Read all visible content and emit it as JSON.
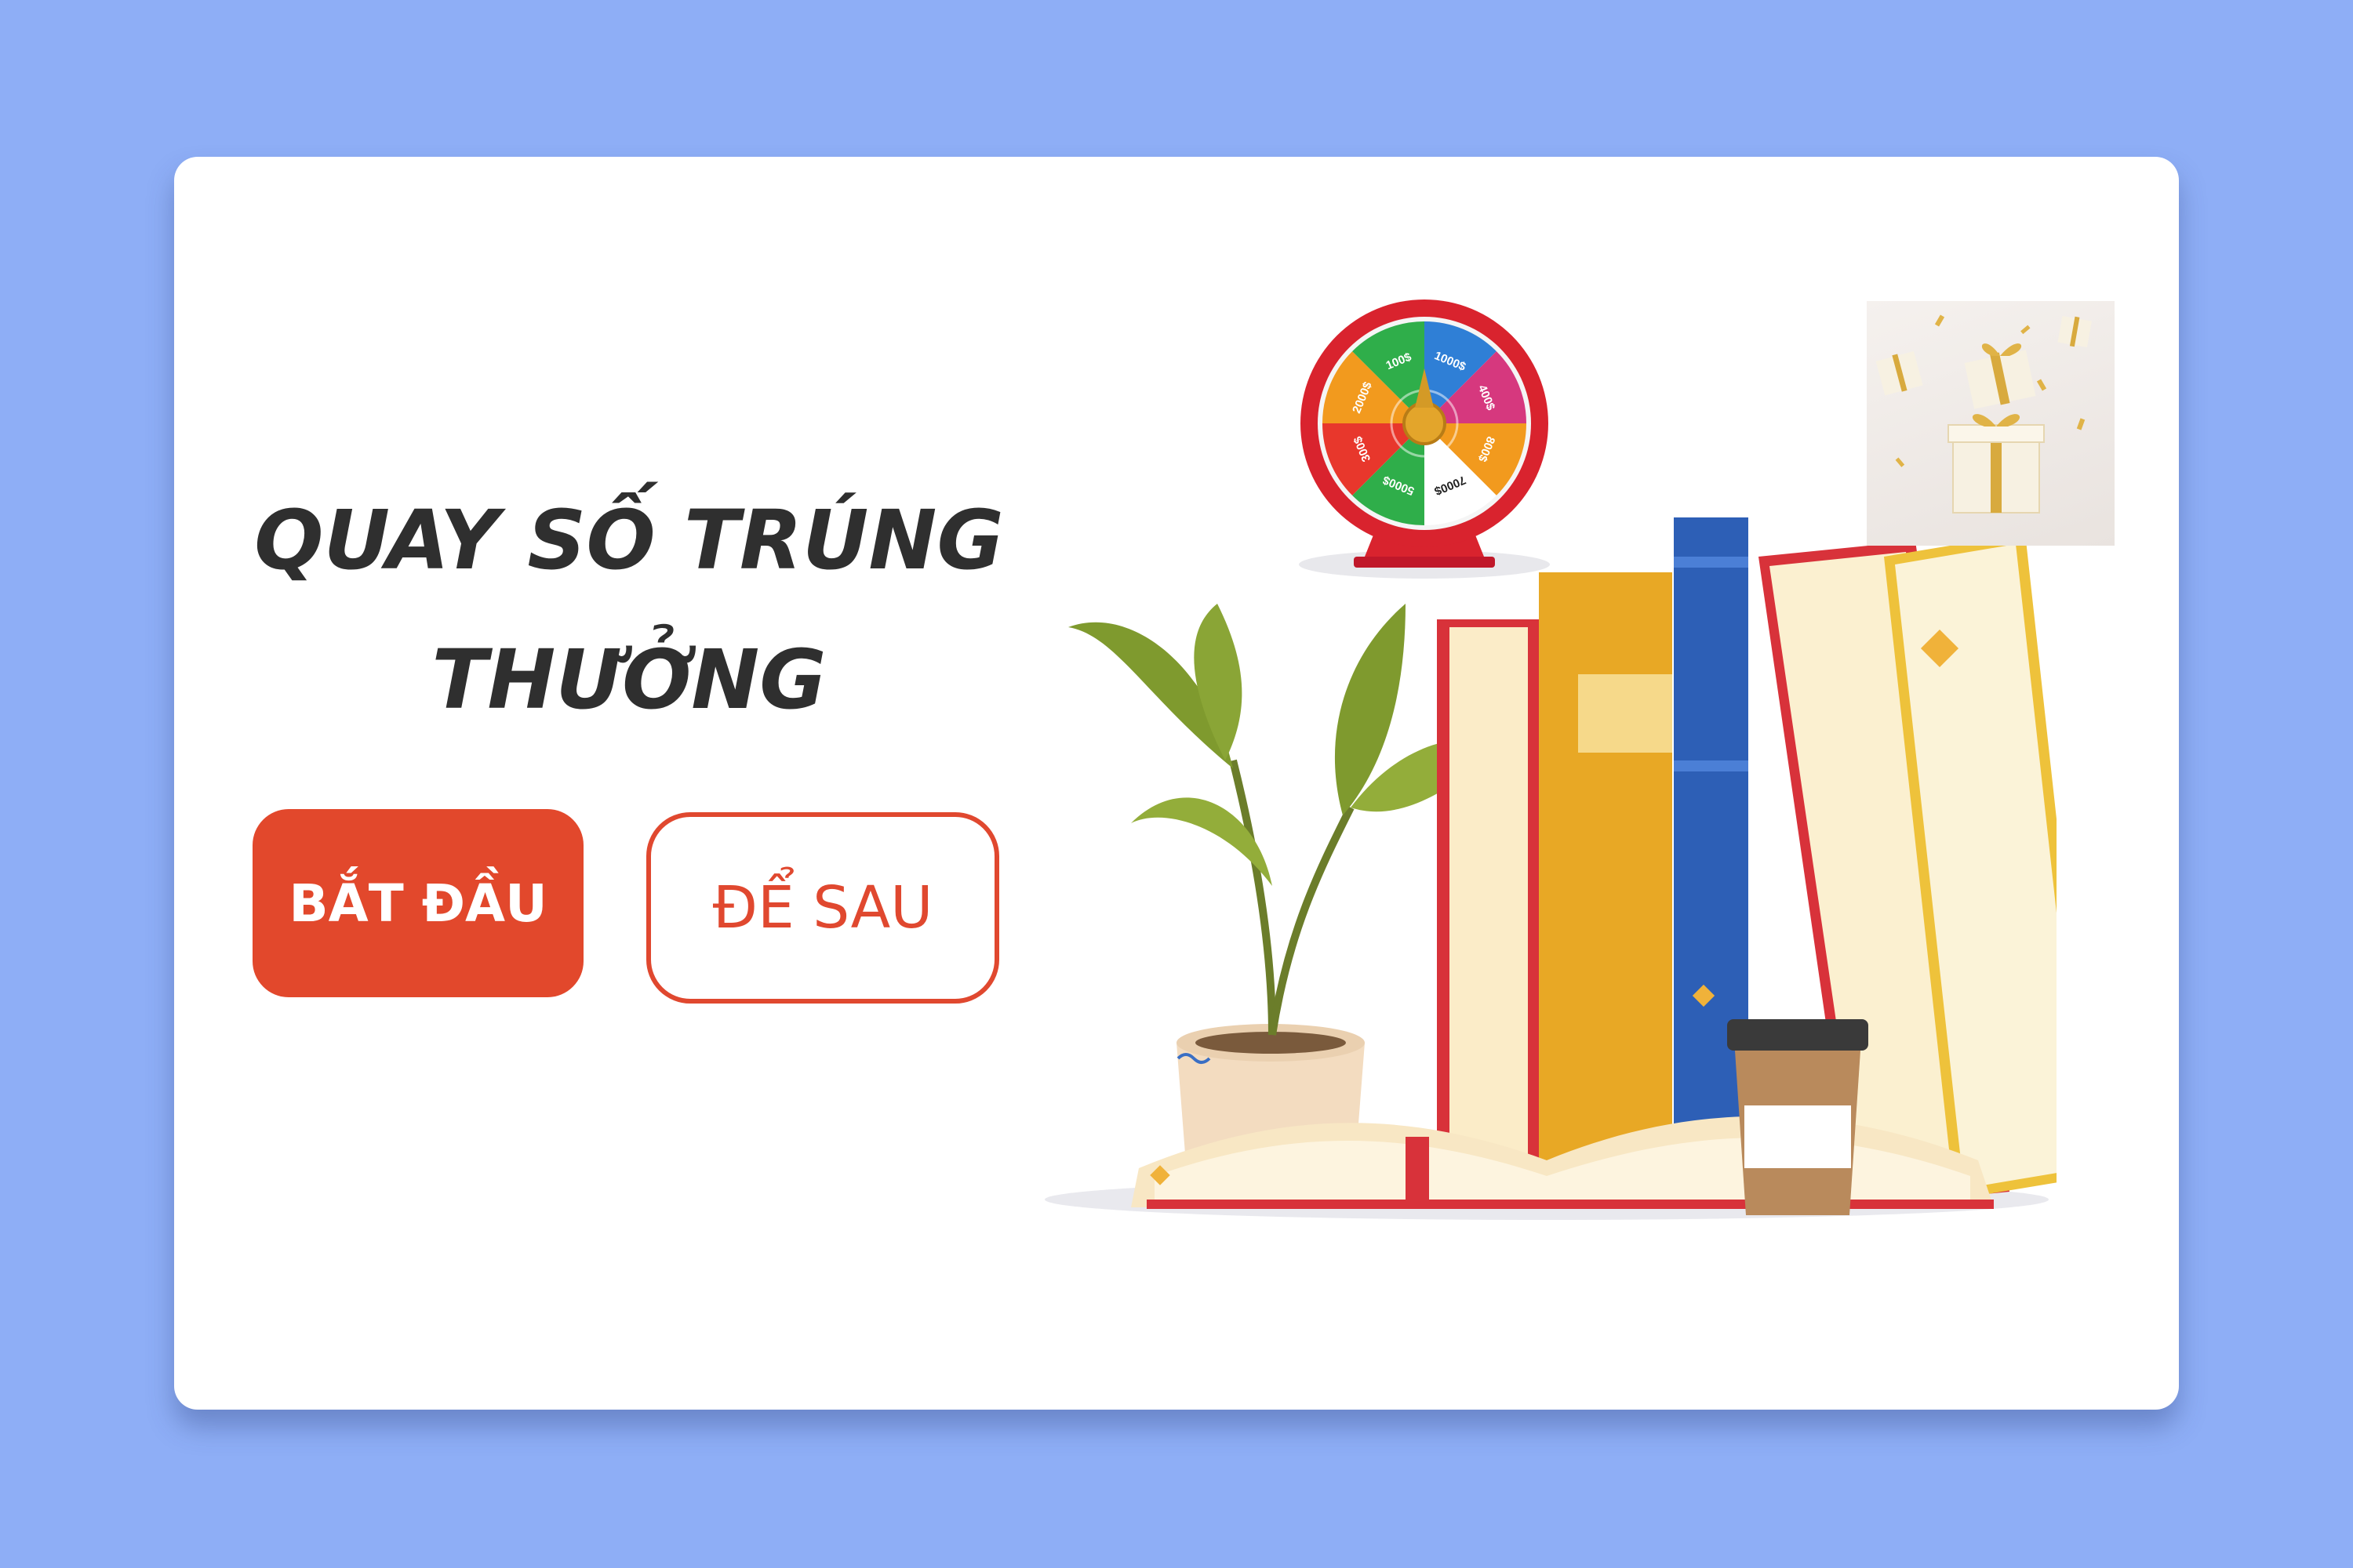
{
  "dialog": {
    "title_line1": "QUAY SỐ TRÚNG",
    "title_line2": "THƯỞNG",
    "start_button": "BẮT ĐẦU",
    "later_button": "ĐỂ SAU"
  },
  "wheel": {
    "segments": [
      {
        "label": "1000$",
        "color": "#2f7fd6"
      },
      {
        "label": "400$",
        "color": "#d6387e"
      },
      {
        "label": "800$",
        "color": "#f29a1e"
      },
      {
        "label": "7000$",
        "color": "#ffffff"
      },
      {
        "label": "5000$",
        "color": "#2fae4a"
      },
      {
        "label": "300$",
        "color": "#e8372c"
      },
      {
        "label": "2000$",
        "color": "#f29a1e"
      },
      {
        "label": "100$",
        "color": "#2fae4a"
      }
    ]
  },
  "colors": {
    "page_bg": "#8eaef6",
    "primary": "#e2482c",
    "title": "#2f2f2f"
  },
  "icons": [
    "prize-wheel-icon",
    "gift-boxes-icon",
    "books-plant-coffee-illustration"
  ]
}
